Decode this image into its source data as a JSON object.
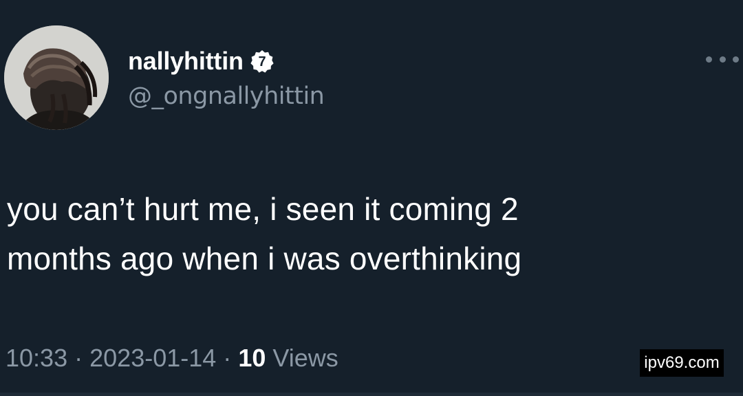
{
  "user": {
    "display_name": "nallyhittin",
    "verified_badge_number": "7",
    "handle": "@_ongnallyhittin"
  },
  "tweet": {
    "line1": "you can’t hurt me, i seen it coming 2",
    "line2": "months ago when i was overthinking"
  },
  "meta": {
    "time": "10:33",
    "separator": "·",
    "date": "2023-01-14",
    "views_count": "10",
    "views_label": "Views"
  },
  "watermark": "ipv69.com",
  "icons": {
    "more": "more-options-icon",
    "badge": "verified-badge-icon"
  },
  "colors": {
    "background": "#15202b",
    "text_primary": "#ffffff",
    "text_secondary": "#8b98a5"
  }
}
